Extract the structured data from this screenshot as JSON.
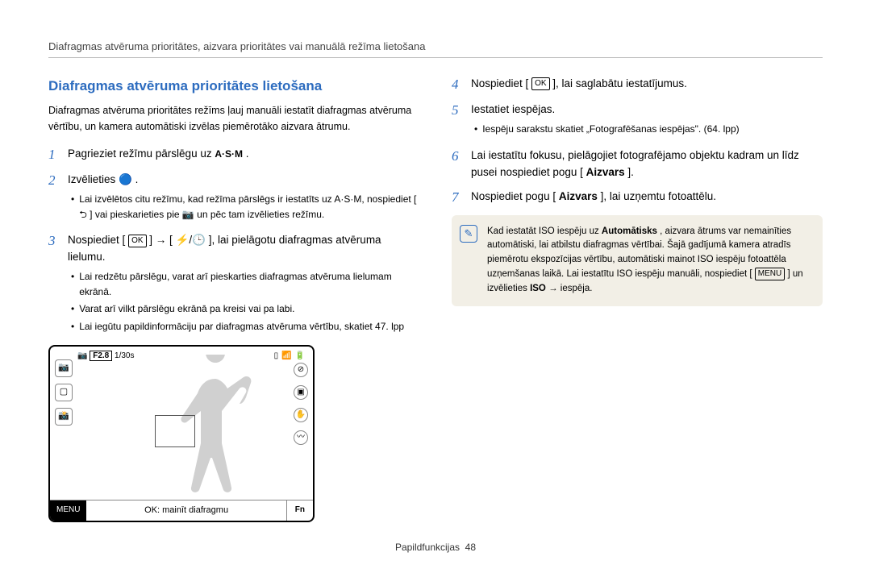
{
  "breadcrumb": "Diafragmas atvēruma prioritātes, aizvara prioritātes vai manuālā režīma lietošana",
  "section_title": "Diafragmas atvēruma prioritātes lietošana",
  "intro": "Diafragmas atvēruma prioritātes režīms ļauj manuāli iestatīt diafragmas atvēruma vērtību, un kamera automātiski izvēlas piemērotāko aizvara ātrumu.",
  "left": {
    "step1": {
      "text_before": "Pagrieziet režīmu pārslēgu uz ",
      "icon": "A·S·M",
      "text_after": "."
    },
    "step2": {
      "text_before": "Izvēlieties ",
      "icon": "🔵",
      "text_after": ".",
      "bullets": [
        "Lai izvēlētos citu režīmu, kad režīma pārslēgs ir iestatīts uz A·S·M, nospiediet [ ⮌ ] vai pieskarieties pie  📷 un pēc tam izvēlieties režīmu."
      ]
    },
    "step3": {
      "text_before": "Nospiediet [",
      "icon_ok": "OK",
      "text_mid": "] → [",
      "icon_flash": "⚡/🕒",
      "text_after": "], lai pielāgotu diafragmas atvēruma lielumu.",
      "bullets": [
        "Lai redzētu pārslēgu, varat arī pieskarties diafragmas atvēruma lielumam ekrānā.",
        "Varat arī vilkt pārslēgu ekrānā pa kreisi vai pa labi.",
        "Lai iegūtu papildinformāciju par diafragmas atvēruma vērtību, skatiet 47. lpp"
      ]
    }
  },
  "right": {
    "step4": {
      "text_before": "Nospiediet [",
      "icon_ok": "OK",
      "text_after": "], lai saglabātu iestatījumus."
    },
    "step5": {
      "text": "Iestatiet iespējas.",
      "bullets": [
        "Iespēju sarakstu skatiet „Fotografēšanas iespējas\". (64. lpp)"
      ]
    },
    "step6": {
      "text_before": "Lai iestatītu fokusu, pielāgojiet fotografējamo objektu kadram un līdz pusei nospiediet pogu [",
      "bold": "Aizvars",
      "text_after": "]."
    },
    "step7": {
      "text_before": "Nospiediet pogu [",
      "bold": "Aizvars",
      "text_after": "], lai uzņemtu fotoattēlu."
    },
    "note": {
      "text_before": "Kad iestatāt ISO iespēju uz ",
      "bold1": "Automātisks",
      "text_mid": ", aizvara ātrums var nemainīties automātiski, lai atbilstu diafragmas vērtībai. Šajā gadījumā kamera atradīs piemērotu ekspozīcijas vērtību, automātiski mainot ISO iespēju fotoattēla uzņemšanas laikā. Lai iestatītu ISO iespēju manuāli, nospiediet [",
      "icon_menu": "MENU",
      "text_mid2": "] un izvēlieties ",
      "bold2": "ISO",
      "text_after": " → iespēja."
    }
  },
  "lcd": {
    "fval": "F2.8",
    "shutter": "1/30s",
    "menu": "MENU",
    "caption": "OK: mainīt diafragmu",
    "fn": "Fn"
  },
  "footer": {
    "label": "Papildfunkcijas",
    "page": "48"
  }
}
